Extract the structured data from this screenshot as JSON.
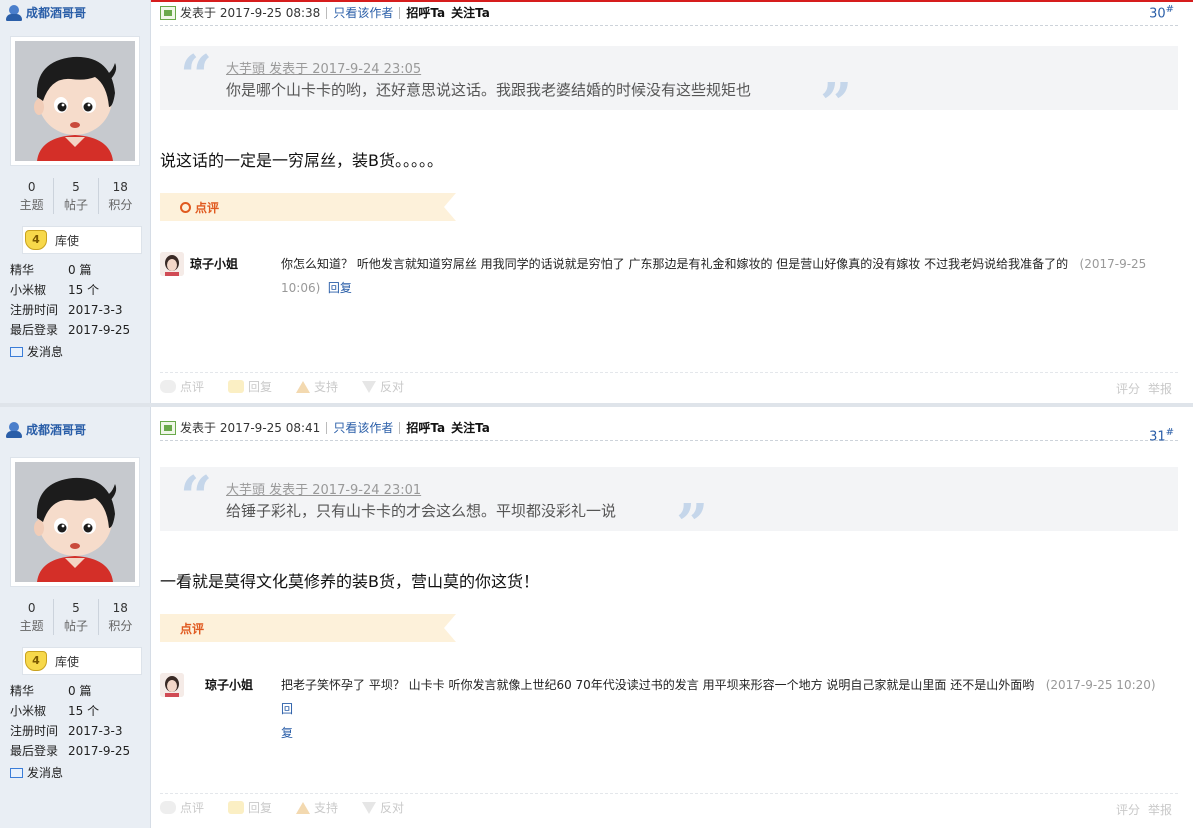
{
  "posts": [
    {
      "author": "成都酒哥哥",
      "stats": [
        {
          "num": "0",
          "label": "主题"
        },
        {
          "num": "5",
          "label": "帖子"
        },
        {
          "num": "18",
          "label": "积分"
        }
      ],
      "rank_level": "4",
      "rank_name": "库使",
      "info": [
        {
          "key": "精华",
          "value": "0 篇"
        },
        {
          "key": "小米椒",
          "value": "15 个"
        },
        {
          "key": "注册时间",
          "value": "2017-3-3"
        },
        {
          "key": "最后登录",
          "value": "2017-9-25"
        }
      ],
      "send_message": "发消息",
      "post_time": "发表于 2017-9-25 08:38",
      "only_author": "只看该作者",
      "greet": "招呼Ta",
      "follow": "关注Ta",
      "floor": "30",
      "floor_sup": "#",
      "quote_meta": "大芋頭 发表于 2017-9-24 23:05",
      "quote_text": "你是哪个山卡卡的哟，还好意思说这话。我跟我老婆结婚的时候没有这些规矩也",
      "body": "说这话的一定是一穷屌丝，装B货。。。。。",
      "dianping_label": "点评",
      "comment": {
        "name": "琼子小姐",
        "text": "你怎么知道？ 听他发言就知道穷屌丝 用我同学的话说就是穷怕了 广东那边是有礼金和嫁妆的 但是营山好像真的没有嫁妆 不过我老妈说给我准备了的",
        "time": "(2017-9-25",
        "time2": "10:06)",
        "reply": "回复"
      },
      "actions": {
        "dianping": "点评",
        "reply": "回复",
        "support": "支持",
        "oppose": "反对",
        "rate": "评分",
        "report": "举报"
      }
    },
    {
      "author": "成都酒哥哥",
      "stats": [
        {
          "num": "0",
          "label": "主题"
        },
        {
          "num": "5",
          "label": "帖子"
        },
        {
          "num": "18",
          "label": "积分"
        }
      ],
      "rank_level": "4",
      "rank_name": "库使",
      "info": [
        {
          "key": "精华",
          "value": "0 篇"
        },
        {
          "key": "小米椒",
          "value": "15 个"
        },
        {
          "key": "注册时间",
          "value": "2017-3-3"
        },
        {
          "key": "最后登录",
          "value": "2017-9-25"
        }
      ],
      "send_message": "发消息",
      "post_time": "发表于 2017-9-25 08:41",
      "only_author": "只看该作者",
      "greet": "招呼Ta",
      "follow": "关注Ta",
      "floor": "31",
      "floor_sup": "#",
      "quote_meta": "大芋頭 发表于 2017-9-24 23:01",
      "quote_text": "给锤子彩礼，只有山卡卡的才会这么想。平坝都没彩礼一说",
      "body": "一看就是莫得文化莫修养的装B货，营山莫的你这货！",
      "dianping_label": "点评",
      "comment": {
        "name": "琼子小姐",
        "text": "把老子笑怀孕了 平坝？ 山卡卡 听你发言就像上世纪60 70年代没读过书的发言 用平坝来形容一个地方 说明自己家就是山里面 还不是山外面哟",
        "time": "(2017-9-25 10:20)",
        "time2": "",
        "reply": "回",
        "reply2": "复"
      },
      "actions": {
        "dianping": "点评",
        "reply": "回复",
        "support": "支持",
        "oppose": "反对",
        "rate": "评分",
        "report": "举报"
      }
    }
  ]
}
